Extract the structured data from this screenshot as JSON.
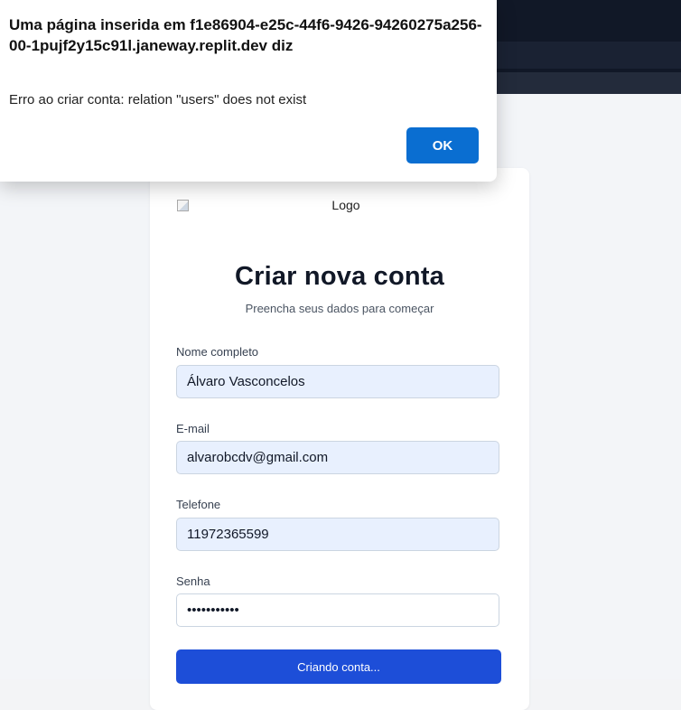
{
  "dialog": {
    "title": "Uma página inserida em f1e86904-e25c-44f6-9426-94260275a256-00-1pujf2y15c91l.janeway.replit.dev diz",
    "message": "Erro ao criar conta: relation \"users\" does not exist",
    "ok_label": "OK"
  },
  "card": {
    "logo_alt": "Logo",
    "title": "Criar nova conta",
    "subtitle": "Preencha seus dados para começar",
    "fields": {
      "name": {
        "label": "Nome completo",
        "value": "Álvaro Vasconcelos"
      },
      "email": {
        "label": "E-mail",
        "value": "alvarobcdv@gmail.com"
      },
      "phone": {
        "label": "Telefone",
        "value": "11972365599"
      },
      "password": {
        "label": "Senha",
        "value": "•••••••••••"
      }
    },
    "submit_label": "Criando conta..."
  },
  "colors": {
    "primary": "#1d4ed8",
    "dialog_ok": "#0a6ed1",
    "autofill_bg": "#e8f0fe"
  }
}
